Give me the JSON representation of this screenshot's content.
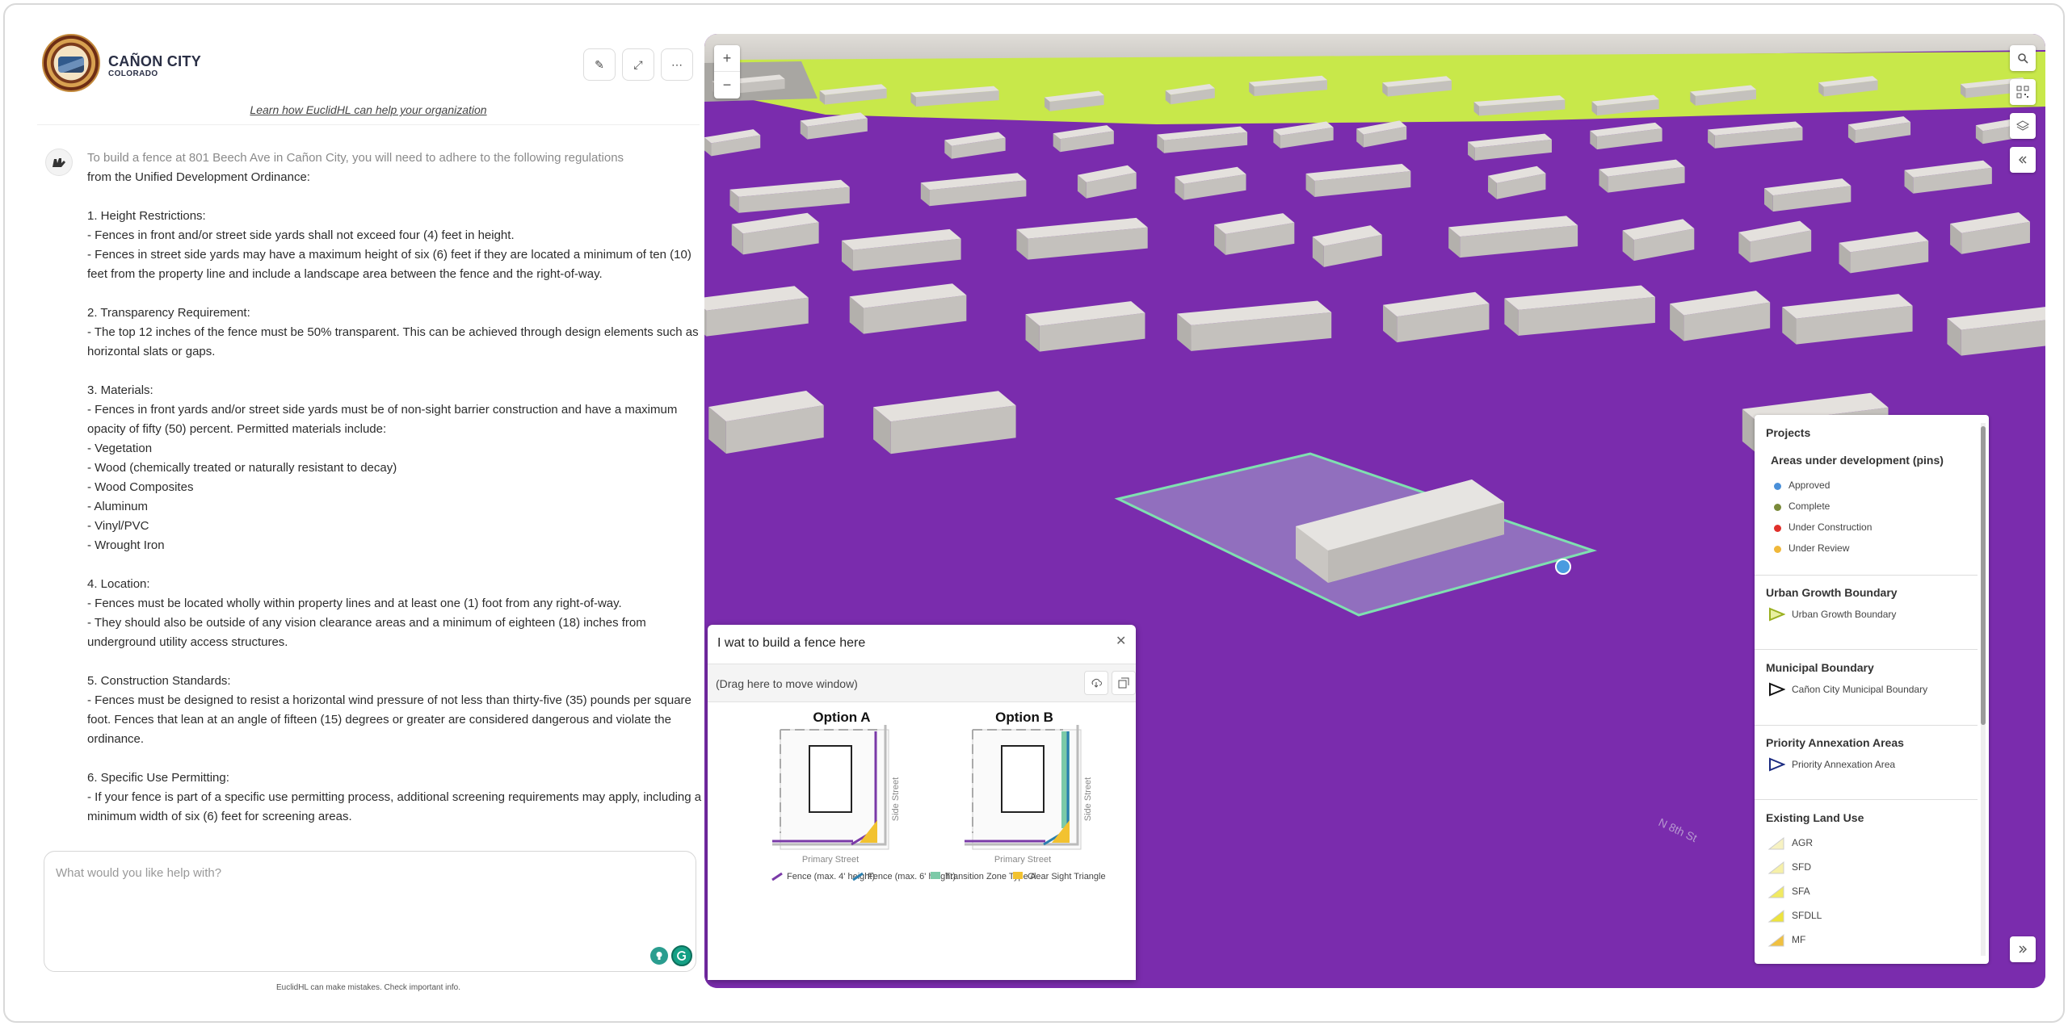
{
  "header": {
    "org_name": "CAÑON CITY",
    "org_sub": "COLORADO",
    "learn_link": "Learn how EuclidHL can help your organization"
  },
  "toolbar": {
    "edit_icon": "✎",
    "expand_icon": "⤢",
    "more_icon": "⋯"
  },
  "chat": {
    "intro_gray": "To build a fence at 801 Beech Ave in Cañon City, you will need to adhere to the following regulations",
    "intro_rest": "from the Unified Development Ordinance:",
    "body": "1. Height Restrictions:\n- Fences in front and/or street side yards shall not exceed four (4) feet in height.\n- Fences in street side yards may have a maximum height of six (6) feet if they are located a minimum of ten (10) feet from the property line and include a landscape area between the fence and the right-of-way.\n\n2. Transparency Requirement:\n- The top 12 inches of the fence must be 50% transparent. This can be achieved through design elements such as horizontal slats or gaps.\n\n3. Materials:\n- Fences in front yards and/or street side yards must be of non-sight barrier construction and have a maximum opacity of fifty (50) percent. Permitted materials include:\n- Vegetation\n- Wood (chemically treated or naturally resistant to decay)\n- Wood Composites\n- Aluminum\n- Vinyl/PVC\n- Wrought Iron\n\n4. Location:\n- Fences must be located wholly within property lines and at least one (1) foot from any right-of-way.\n- They should also be outside of any vision clearance areas and a minimum of eighteen (18) inches from underground utility access structures.\n\n5. Construction Standards:\n- Fences must be designed to resist a horizontal wind pressure of not less than thirty-five (35) pounds per square foot. Fences that lean at an angle of fifteen (15) degrees or greater are considered dangerous and violate the ordinance.\n\n6. Specific Use Permitting:\n- If your fence is part of a specific use permitting process, additional screening requirements may apply, including a minimum width of six (6) feet for screening areas.",
    "input_placeholder": "What would you like help with?",
    "disclaimer": "EuclidHL can make mistakes. Check important info."
  },
  "map": {
    "zoom_in": "+",
    "zoom_out": "−",
    "street_label": "N 8th St",
    "colors": {
      "zoning_purple": "#7a2cad",
      "zone_lime": "#c8e84a",
      "building": "#d4d1cd",
      "parcel_outline": "#7fe0b0"
    }
  },
  "legend": {
    "title": "Projects",
    "pins_title": "Areas under development (pins)",
    "pins": [
      {
        "label": "Approved",
        "color": "#4a90d9"
      },
      {
        "label": "Complete",
        "color": "#7a8a3a"
      },
      {
        "label": "Under Construction",
        "color": "#e0302a"
      },
      {
        "label": "Under Review",
        "color": "#f0b83a"
      }
    ],
    "ugb_title": "Urban Growth Boundary",
    "ugb_item": "Urban Growth Boundary",
    "muni_title": "Municipal Boundary",
    "muni_item": "Cañon City Municipal Boundary",
    "paa_title": "Priority Annexation Areas",
    "paa_item": "Priority Annexation Area",
    "lu_title": "Existing Land Use",
    "land_use": [
      {
        "label": "AGR",
        "color": "#f7f2c2"
      },
      {
        "label": "SFD",
        "color": "#f6f0a8"
      },
      {
        "label": "SFA",
        "color": "#f1ea62"
      },
      {
        "label": "SFDLL",
        "color": "#ede33e"
      },
      {
        "label": "MF",
        "color": "#f0c040"
      }
    ]
  },
  "window": {
    "title": "I wat to build a fence here",
    "drag_hint": "(Drag here to move window)",
    "option_a": "Option A",
    "option_b": "Option B",
    "side_street": "Side Street",
    "primary_street": "Primary Street",
    "legend": [
      {
        "label": "Fence (max. 4' height)",
        "color": "#7a3aa8"
      },
      {
        "label": "Fence (max. 6' height)",
        "color": "#2a7fb0"
      },
      {
        "label": "Transition Zone Type A",
        "color": "#7ccaa8"
      },
      {
        "label": "Clear Sight Triangle",
        "color": "#f2c230"
      }
    ]
  }
}
